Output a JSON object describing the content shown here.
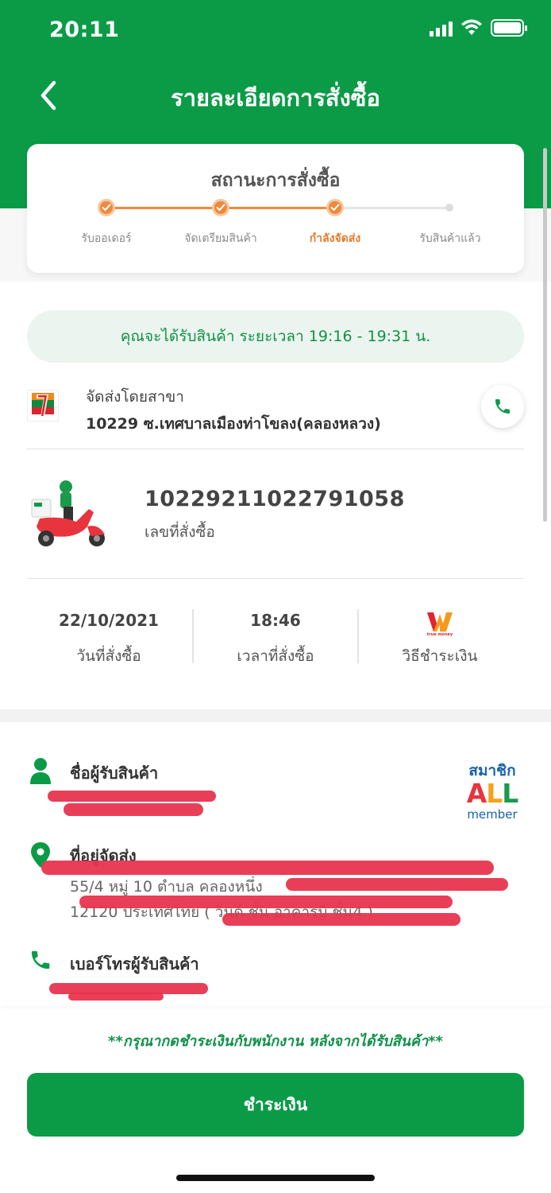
{
  "status_bar": {
    "time": "20:11"
  },
  "header": {
    "title": "รายละเอียดการสั่งซื้อ"
  },
  "order_status": {
    "title": "สถานะการสั่งซื้อ",
    "steps": [
      {
        "label": "รับออเดอร์",
        "state": "done"
      },
      {
        "label": "จัดเตรียมสินค้า",
        "state": "done"
      },
      {
        "label": "กำลังจัดส่ง",
        "state": "current"
      },
      {
        "label": "รับสินค้าแล้ว",
        "state": "pending"
      }
    ],
    "accent_color": "#ec8a3d"
  },
  "eta": {
    "text": "คุณจะได้รับสินค้า ระยะเวลา 19:16 - 19:31 น."
  },
  "branch": {
    "label": "จัดส่งโดยสาขา",
    "name": "10229 ซ.เทศบาลเมืองท่าโขลง(คลองหลวง)",
    "logo": "7-eleven-logo",
    "call_icon": "phone-icon"
  },
  "order": {
    "number": "10229211022791058",
    "number_label": "เลขที่สั่งซื้อ"
  },
  "order_info": {
    "date_value": "22/10/2021",
    "date_label": "วันที่สั่งซื้อ",
    "time_value": "18:46",
    "time_label": "เวลาที่สั่งซื้อ",
    "payment_icon": "truemoney-wallet-logo",
    "payment_label": "วิธีชำระเงิน"
  },
  "recipient": {
    "name_title": "ชื่อผู้รับสินค้า",
    "address_title": "ที่อยู่จัดส่ง",
    "address_line1": "55/4 หมู่ 10 ตำบล คลองหนึ่ง",
    "address_line2": "12120 ประเทศไทย ( วินด์ ชั้น อาคารบี ชั้น4 )",
    "phone_title": "เบอร์โทรผู้รับสินค้า"
  },
  "all_member": {
    "top": "สมาชิก",
    "main": "ALL",
    "bottom": "member"
  },
  "footer": {
    "note": "**กรุณากดชำระเงินกับพนักงาน หลังจากได้รับสินค้า**",
    "pay_button": "ชำระเงิน"
  },
  "colors": {
    "brand_green": "#0b9b47",
    "eta_text": "#11914a",
    "redaction": "#e8344e"
  }
}
